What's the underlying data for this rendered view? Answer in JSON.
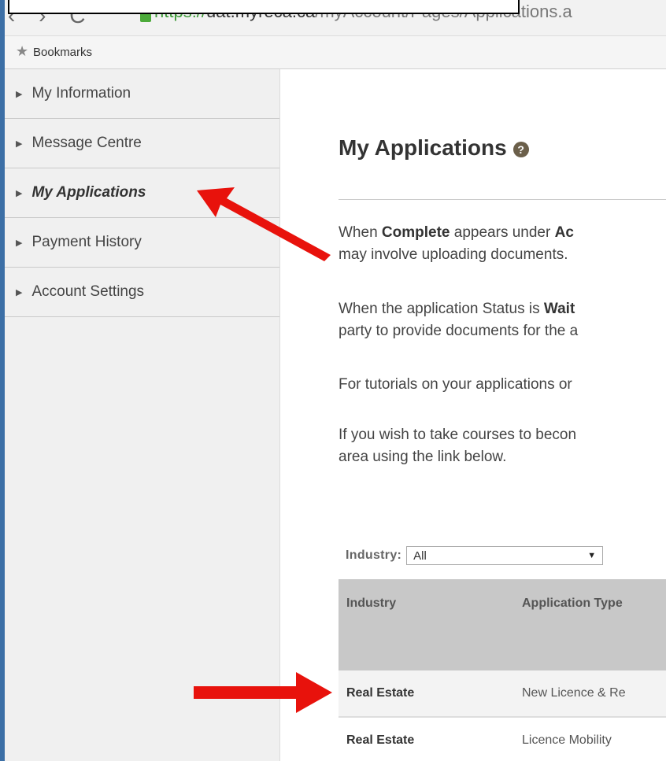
{
  "browser": {
    "url_scheme": "https://",
    "url_host": "uat.myreca.ca",
    "url_path": "/myAccount/Pages/Applications.a",
    "bookmarks_label": "Bookmarks",
    "star_glyph": "★"
  },
  "sidebar": {
    "items": [
      {
        "label": "My Information",
        "active": false
      },
      {
        "label": "Message Centre",
        "active": false
      },
      {
        "label": "My Applications",
        "active": true
      },
      {
        "label": "Payment History",
        "active": false
      },
      {
        "label": "Account Settings",
        "active": false
      }
    ]
  },
  "main": {
    "title": "My Applications",
    "help_icon_glyph": "?",
    "para1_line1_pre": "When ",
    "para1_line1_bold1": "Complete",
    "para1_line1_mid": " appears under ",
    "para1_line1_bold2": "Ac",
    "para1_line2": "may involve uploading documents.",
    "para2_line1_pre": "When the application Status is ",
    "para2_line1_bold": "Wait",
    "para2_line2": "party to provide documents for the a",
    "para3": "For tutorials on your applications or",
    "para4_line1": "If you wish to take courses to becon",
    "para4_line2": "area using the link below."
  },
  "filter": {
    "label": "Industry:",
    "selected": "All"
  },
  "table": {
    "headers": [
      "Industry",
      "Application Type"
    ],
    "rows": [
      [
        "Real Estate",
        "New Licence & Re"
      ],
      [
        "Real Estate",
        "Licence Mobility"
      ]
    ]
  },
  "colors": {
    "annotation_arrow": "#e8120c",
    "url_green": "#3f9a3a"
  }
}
